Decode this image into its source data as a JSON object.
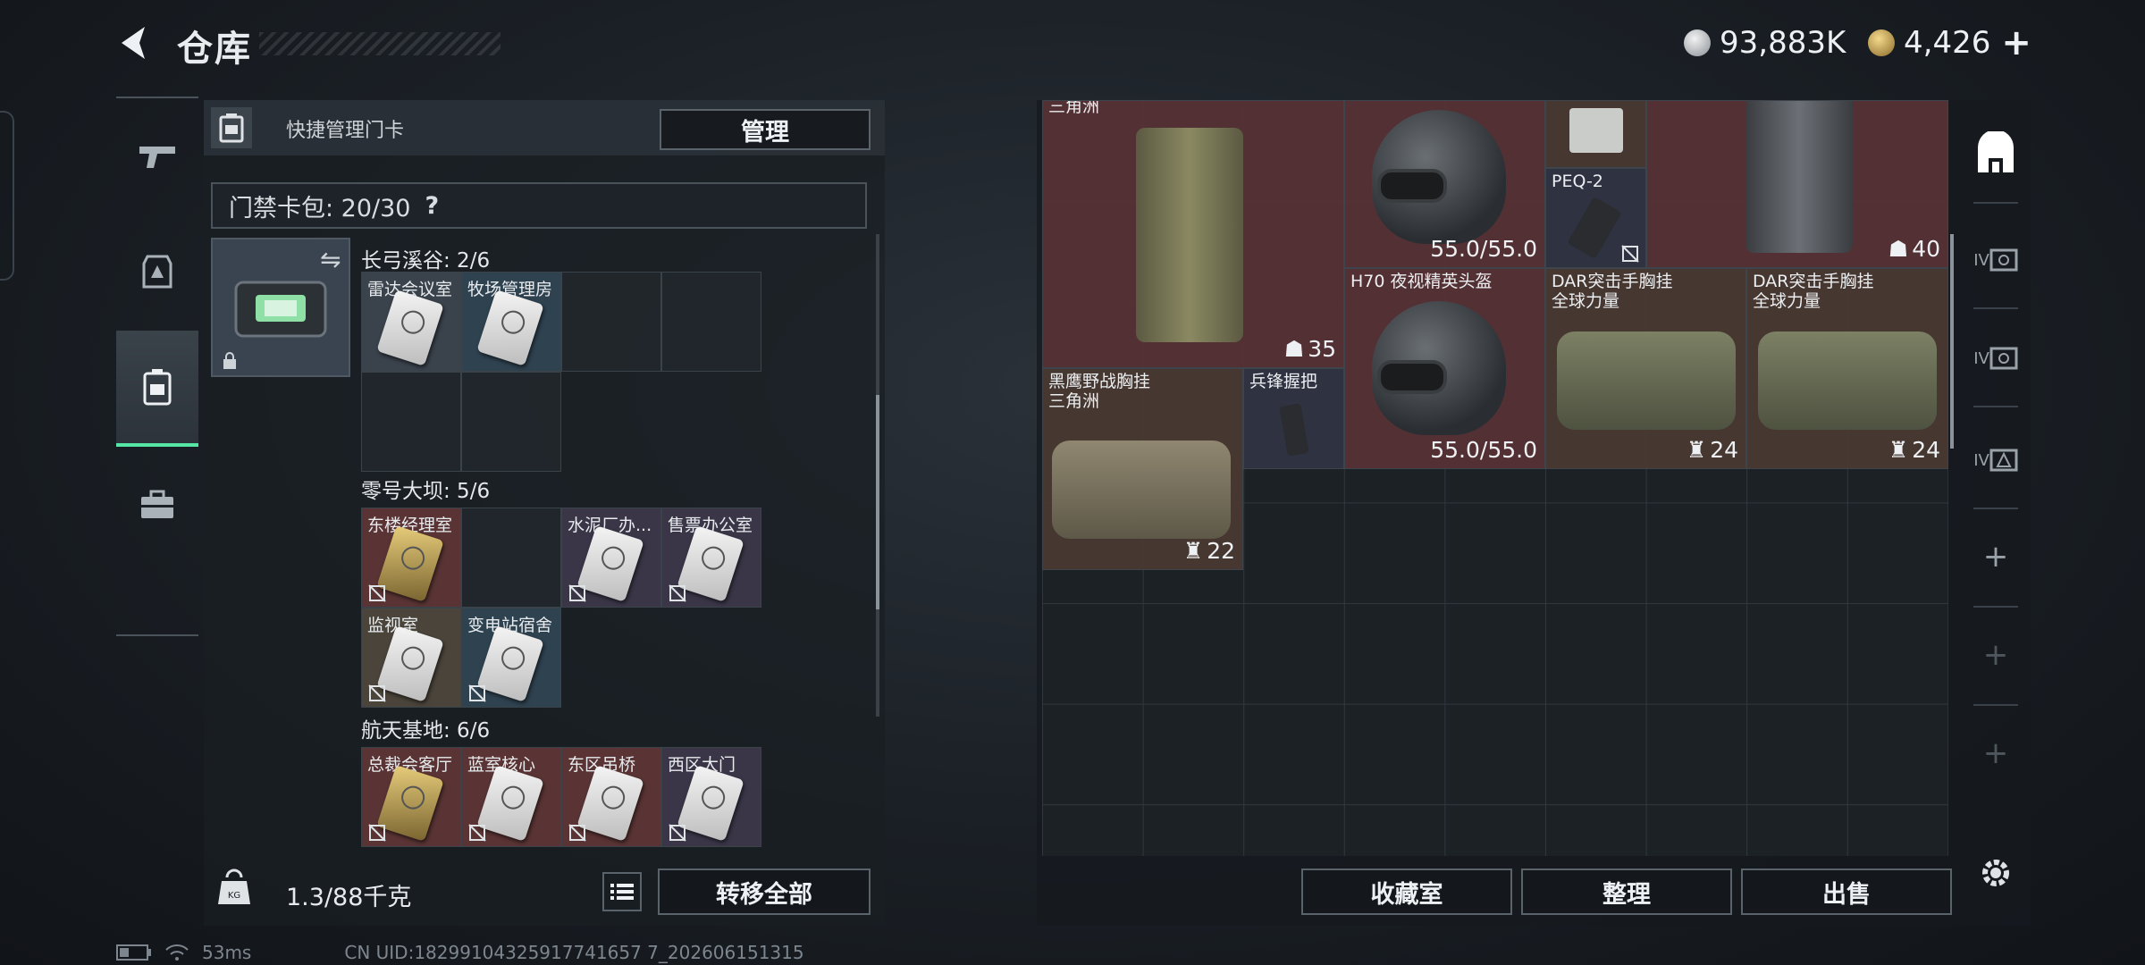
{
  "header": {
    "title": "仓库"
  },
  "currency": {
    "silver": "93,883K",
    "gold": "4,426",
    "add_symbol": "+"
  },
  "left_panel": {
    "header_label": "快捷管理门卡",
    "manage_label": "管理",
    "keybag_label": "门禁卡包: 20/30",
    "keybag_help": "?",
    "sections": [
      {
        "title": "长弓溪谷: 2/6",
        "cards": [
          {
            "name": "雷达会议室"
          },
          {
            "name": "牧场管理房"
          }
        ]
      },
      {
        "title": "零号大坝: 5/6",
        "cards": [
          {
            "name": "东楼经理室"
          },
          {
            "name": ""
          },
          {
            "name": "水泥厂办..."
          },
          {
            "name": "售票办公室"
          },
          {
            "name": "监视室"
          },
          {
            "name": "变电站宿舍"
          }
        ]
      },
      {
        "title": "航天基地: 6/6",
        "cards": [
          {
            "name": "总裁会客厅"
          },
          {
            "name": "蓝室核心"
          },
          {
            "name": "东区吊桥"
          },
          {
            "name": "西区大门"
          }
        ]
      }
    ],
    "weight": "1.3/88千克",
    "transfer_all_label": "转移全部"
  },
  "stash": {
    "items": [
      {
        "name": "三角洲",
        "value": "35"
      },
      {
        "name": "",
        "value": "55.0/55.0"
      },
      {
        "name": "",
        "value": ""
      },
      {
        "name": "PEQ-2",
        "value": ""
      },
      {
        "name": "",
        "value": "40"
      },
      {
        "name": "H70 夜视精英头盔",
        "value": "55.0/55.0"
      },
      {
        "name": "DAR突击手胸挂\n全球力量",
        "value": "24"
      },
      {
        "name": "DAR突击手胸挂\n全球力量",
        "value": "24"
      },
      {
        "name": "黑鹰野战胸挂\n三角洲",
        "value": "22"
      },
      {
        "name": "兵锋握把",
        "value": ""
      }
    ],
    "buttons": {
      "collection": "收藏室",
      "sort": "整理",
      "sell": "出售"
    }
  },
  "sidebar": {
    "slot_labels": [
      "IV",
      "IV",
      "IV"
    ],
    "add_symbol": "+"
  },
  "status_bar": {
    "ping": "53ms",
    "uid": "CN UID:18299104325917741657 7_202606151315"
  }
}
